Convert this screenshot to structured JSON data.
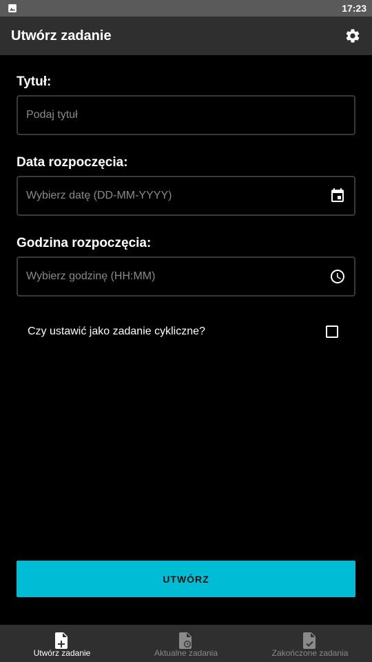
{
  "status_bar": {
    "time": "17:23"
  },
  "app_bar": {
    "title": "Utwórz zadanie",
    "settings_icon": "gear-icon"
  },
  "form": {
    "title": {
      "label": "Tytuł:",
      "placeholder": "Podaj tytuł",
      "value": ""
    },
    "start_date": {
      "label": "Data rozpoczęcia:",
      "placeholder": "Wybierz datę (DD-MM-YYYY)",
      "value": "",
      "icon": "calendar-icon"
    },
    "start_time": {
      "label": "Godzina rozpoczęcia:",
      "placeholder": "Wybierz godzinę (HH:MM)",
      "value": "",
      "icon": "clock-icon"
    },
    "cyclic": {
      "label": "Czy ustawić jako zadanie cykliczne?",
      "checked": false
    }
  },
  "create_button": {
    "label": "UTWÓRZ"
  },
  "colors": {
    "accent": "#00bcd4",
    "app_bar": "#2f2f2f",
    "status_bar": "#5a5a5a",
    "background": "#000000",
    "inactive_text": "#8a8a8a"
  },
  "bottom_nav": {
    "items": [
      {
        "label": "Utwórz zadanie",
        "icon": "file-plus-icon",
        "active": true
      },
      {
        "label": "Aktualne zadania",
        "icon": "file-clock-icon",
        "active": false
      },
      {
        "label": "Zakończone zadania",
        "icon": "file-check-icon",
        "active": false
      }
    ]
  }
}
